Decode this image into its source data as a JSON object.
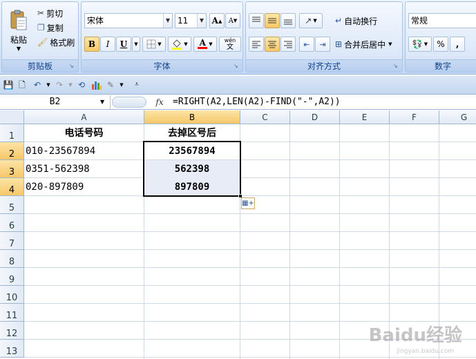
{
  "ribbon": {
    "clipboard": {
      "label": "剪贴板",
      "paste": "粘贴",
      "cut": "剪切",
      "copy": "复制",
      "format_painter": "格式刷"
    },
    "font": {
      "label": "字体",
      "font_name": "宋体",
      "font_size": "11",
      "bold": "B",
      "italic": "I",
      "underline": "U",
      "grow": "A",
      "shrink": "A",
      "phonetic": "wén"
    },
    "alignment": {
      "label": "对齐方式",
      "wrap_text": "自动换行",
      "merge_center": "合并后居中"
    },
    "number": {
      "label": "数字",
      "format": "常规",
      "percent": "%",
      "comma": ","
    }
  },
  "formula_bar": {
    "name_box": "B2",
    "fx": "fx",
    "formula": "=RIGHT(A2,LEN(A2)-FIND(\"-\",A2))"
  },
  "sheet": {
    "columns": [
      "A",
      "B",
      "C",
      "D",
      "E",
      "F",
      "G"
    ],
    "rows": [
      "1",
      "2",
      "3",
      "4",
      "5",
      "6",
      "7",
      "8",
      "9",
      "10",
      "11",
      "12",
      "13"
    ],
    "header_a": "电话号码",
    "header_b": "去掉区号后",
    "data": [
      {
        "phone": "010-23567894",
        "result": "23567894"
      },
      {
        "phone": "0351-562398",
        "result": "562398"
      },
      {
        "phone": "020-897809",
        "result": "897809"
      }
    ]
  },
  "watermark": {
    "brand": "Baidu经验",
    "url": "jingyan.baidu.com"
  }
}
